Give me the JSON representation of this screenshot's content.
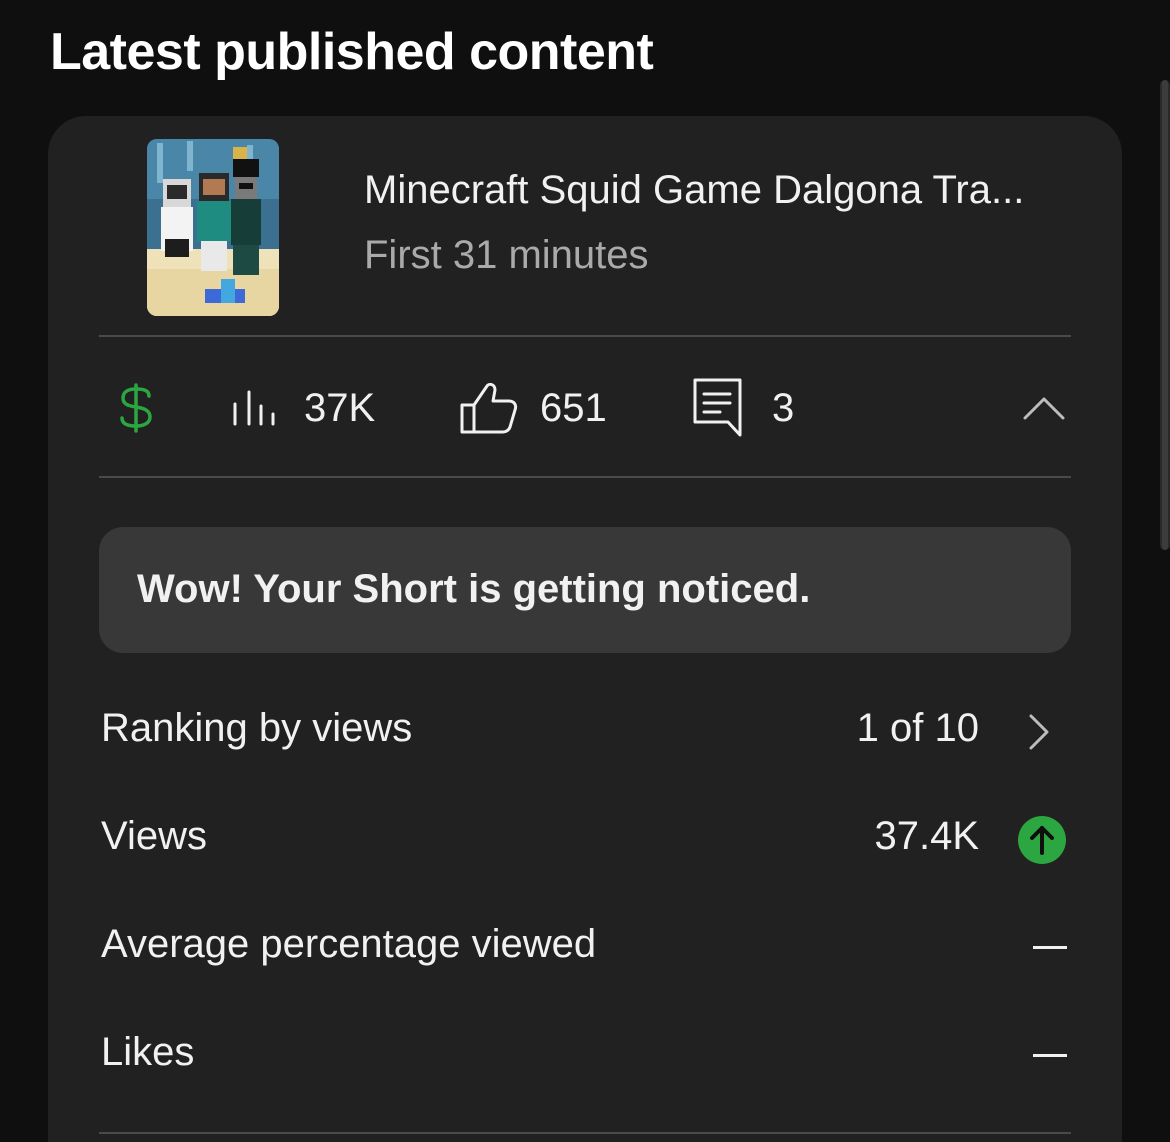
{
  "section": {
    "title": "Latest published content"
  },
  "video": {
    "title": "Minecraft Squid Game Dalgona Tra...",
    "subtitle": "First 31 minutes",
    "thumbnail_icon": "video-thumbnail"
  },
  "stats": {
    "monetization_icon": "dollar-icon",
    "monetization_color": "#2ba640",
    "views_icon": "bar-chart-icon",
    "views": "37K",
    "likes_icon": "thumbs-up-icon",
    "likes": "651",
    "comments_icon": "comment-icon",
    "comments": "3",
    "collapse_icon": "chevron-up-icon"
  },
  "notice": {
    "text": "Wow! Your Short is getting noticed."
  },
  "metrics": [
    {
      "label": "Ranking by views",
      "value": "1 of 10",
      "trailing": "chevron-right-icon"
    },
    {
      "label": "Views",
      "value": "37.4K",
      "trailing": "arrow-up-circle-icon",
      "trailing_color": "#2ba640"
    },
    {
      "label": "Average percentage viewed",
      "value": "",
      "trailing": "dash-icon"
    },
    {
      "label": "Likes",
      "value": "",
      "trailing": "dash-icon"
    }
  ]
}
